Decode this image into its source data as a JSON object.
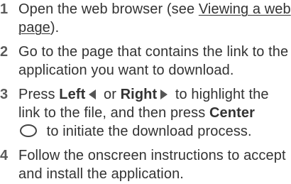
{
  "steps": [
    {
      "number": "1",
      "text_before": "Open the web browser (see ",
      "link_text": "Viewing a web page",
      "text_after": ")."
    },
    {
      "number": "2",
      "text": "Go to the page that contains the link to the application you want to download."
    },
    {
      "number": "3",
      "text_1": "Press ",
      "key_left": "Left",
      "icon_left": "left-arrow-icon",
      "text_2": " or ",
      "key_right": "Right",
      "icon_right": "right-arrow-icon",
      "text_3": " to highlight the link to the file, and then press ",
      "key_center": "Center",
      "icon_center": "center-button-icon",
      "text_4": " to initiate the download process."
    },
    {
      "number": "4",
      "text": "Follow the onscreen instructions to accept and install the application."
    }
  ],
  "colors": {
    "text": "#333333",
    "step_number": "#5a5a5a",
    "icon": "#555555"
  }
}
